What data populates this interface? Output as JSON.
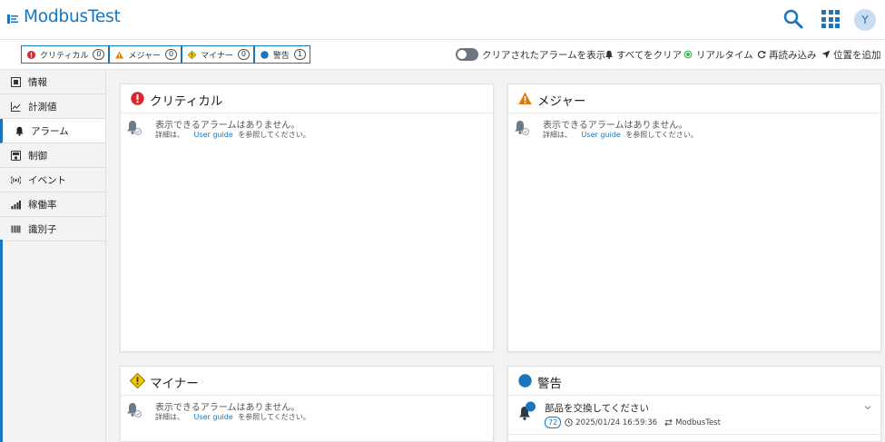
{
  "app": {
    "title": "ModbusTest",
    "avatar_initial": "Y"
  },
  "filters": [
    {
      "label": "クリティカル",
      "count": "0",
      "icon": "critical-icon"
    },
    {
      "label": "メジャー",
      "count": "0",
      "icon": "major-icon"
    },
    {
      "label": "マイナー",
      "count": "0",
      "icon": "minor-icon"
    },
    {
      "label": "警告",
      "count": "1",
      "icon": "warning-icon"
    }
  ],
  "toolbar": {
    "show_cleared": "クリアされたアラームを表示",
    "clear_all": "すべてをクリア",
    "realtime": "リアルタイム",
    "reload": "再読み込み",
    "add_location": "位置を追加"
  },
  "sidebar": {
    "items": [
      {
        "label": "情報",
        "icon": "info-icon"
      },
      {
        "label": "計測値",
        "icon": "chart-line-icon"
      },
      {
        "label": "アラーム",
        "icon": "bell-icon",
        "active": true
      },
      {
        "label": "制御",
        "icon": "control-icon"
      },
      {
        "label": "イベント",
        "icon": "broadcast-icon"
      },
      {
        "label": "稼働率",
        "icon": "bar-chart-icon"
      },
      {
        "label": "識別子",
        "icon": "barcode-icon"
      }
    ]
  },
  "cards": {
    "critical": {
      "title": "クリティカル"
    },
    "major": {
      "title": "メジャー"
    },
    "minor": {
      "title": "マイナー"
    },
    "warning": {
      "title": "警告"
    }
  },
  "empty": {
    "message": "表示できるアラームはありません。",
    "sub_prefix": "詳細は、",
    "link": "User guide",
    "sub_suffix": "を参照してください。"
  },
  "alarm": {
    "text": "部品を交換してください",
    "count": "72",
    "timestamp": "2025/01/24 16:59:36",
    "source": "ModbusTest"
  },
  "colors": {
    "primary": "#1776bf",
    "critical": "#d9262c",
    "major": "#e07b00",
    "minor": "#f2c600",
    "warning": "#1776bf",
    "realtime": "#3cb94a"
  }
}
